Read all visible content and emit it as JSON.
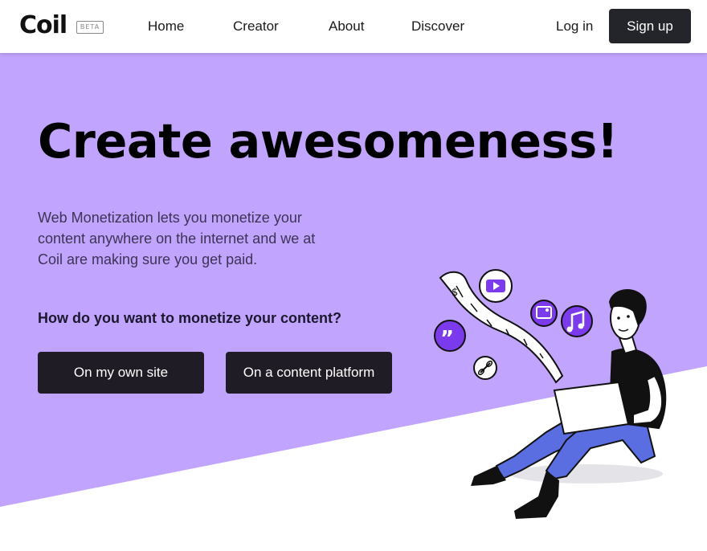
{
  "brand": {
    "name": "Coil",
    "badge": "BETA"
  },
  "nav": {
    "items": [
      "Home",
      "Creator",
      "About",
      "Discover"
    ],
    "login": "Log in",
    "signup": "Sign up"
  },
  "hero": {
    "title": "Create awesomeness!",
    "lede": "Web Monetization lets you monetize your content anywhere on the internet and we at Coil are making sure you get paid.",
    "question": "How do you want to monetize your content?",
    "buttons": [
      "On my own site",
      "On a content platform"
    ]
  },
  "colors": {
    "hero_bg": "#c1a4fd",
    "button_dark": "#1f1c26",
    "icon_purple": "#7c3aed",
    "pants_blue": "#5b6ee1"
  }
}
